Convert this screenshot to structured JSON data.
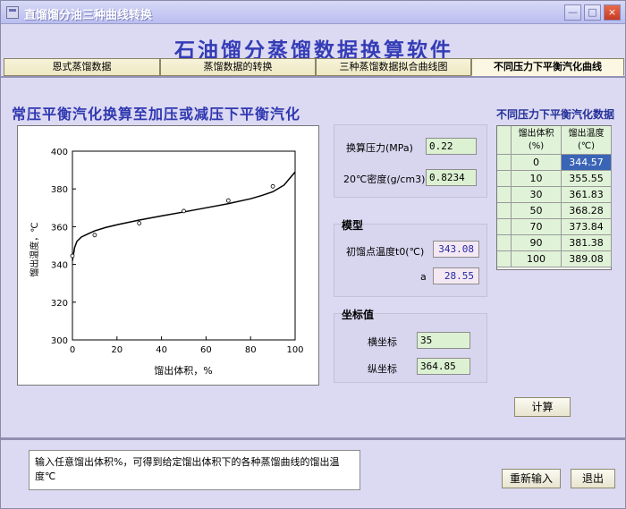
{
  "window": {
    "title": "直馏馏分油三种曲线转换",
    "controls": {
      "minimize": "—",
      "maximize": "□",
      "close": "×"
    }
  },
  "app_title": "石油馏分蒸馏数据换算软件",
  "tabs": [
    "恩式蒸馏数据",
    "蒸馏数据的转换",
    "三种蒸馏数据拟合曲线图",
    "不同压力下平衡汽化曲线"
  ],
  "section_heading": "常压平衡汽化换算至加压或减压下平衡汽化",
  "chart_data": {
    "type": "line",
    "xlabel": "馏出体积，%",
    "ylabel": "馏出温度，℃",
    "xlim": [
      0,
      100
    ],
    "ylim": [
      300,
      400
    ],
    "x_ticks": [
      "0",
      "20",
      "40",
      "60",
      "80",
      "100"
    ],
    "y_ticks": [
      "300",
      "320",
      "340",
      "360",
      "380",
      "400"
    ],
    "curve": {
      "x": [
        0,
        1,
        2,
        4,
        7,
        10,
        15,
        20,
        30,
        40,
        50,
        60,
        70,
        80,
        85,
        90,
        95,
        100
      ],
      "y": [
        342.0,
        349.0,
        352.2,
        354.5,
        356.2,
        357.8,
        359.6,
        361.0,
        363.5,
        365.7,
        367.8,
        370.0,
        372.2,
        374.8,
        376.5,
        378.5,
        382.0,
        389.0
      ]
    },
    "markers": {
      "x": [
        0,
        10,
        30,
        50,
        70,
        90
      ],
      "y": [
        344.57,
        355.55,
        361.83,
        368.28,
        373.84,
        381.38
      ]
    }
  },
  "pressure_group": {
    "pressure_label": "换算压力(MPa)",
    "pressure_value": "0.22",
    "density_label": "20℃密度(g/cm3)",
    "density_value": "0.8234"
  },
  "model_group": {
    "title": "模型",
    "t0_label": "初馏点温度t0(℃)",
    "t0_value": "343.08",
    "a_label": "a",
    "a_value": "28.55"
  },
  "coord_group": {
    "title": "坐标值",
    "x_label": "横坐标",
    "x_value": "35",
    "y_label": "纵坐标",
    "y_value": "364.85"
  },
  "table": {
    "title": "不同压力下平衡汽化数据",
    "col1": [
      "馏出体积",
      "(%)"
    ],
    "col2": [
      "馏出温度",
      "(℃)"
    ],
    "rows": [
      {
        "v": "0",
        "t": "344.57"
      },
      {
        "v": "10",
        "t": "355.55"
      },
      {
        "v": "30",
        "t": "361.83"
      },
      {
        "v": "50",
        "t": "368.28"
      },
      {
        "v": "70",
        "t": "373.84"
      },
      {
        "v": "90",
        "t": "381.38"
      },
      {
        "v": "100",
        "t": "389.08"
      }
    ]
  },
  "buttons": {
    "calc": "计算",
    "reinput": "重新输入",
    "exit": "退出"
  },
  "info_text": "输入任意馏出体积%，可得到给定馏出体积下的各种蒸馏曲线的馏出温度℃"
}
